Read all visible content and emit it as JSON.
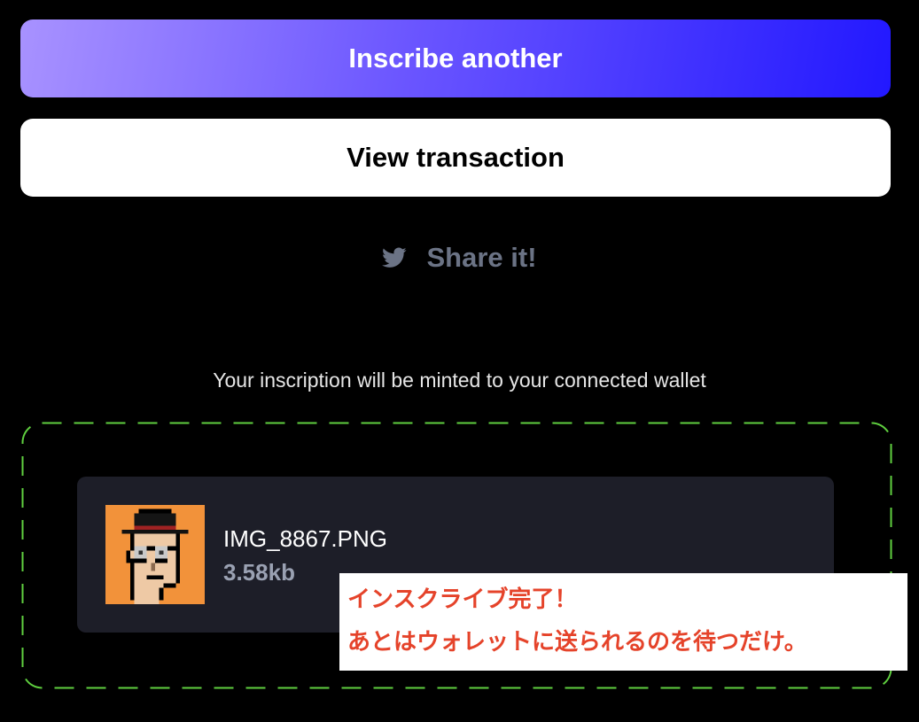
{
  "actions": {
    "inscribe_another_label": "Inscribe another",
    "view_transaction_label": "View transaction",
    "share_label": "Share it!"
  },
  "mint_note": "Your inscription will be minted to your connected wallet",
  "file": {
    "name": "IMG_8867.PNG",
    "size": "3.58kb"
  },
  "annotation": {
    "line1": "インスクライブ完了！",
    "line2": "あとはウォレットに送られるのを待つだけ。"
  },
  "icons": {
    "share_icon": "twitter-bird-icon",
    "thumbnail": "pixel-punk-avatar"
  },
  "colors": {
    "gradient_start": "#a892ff",
    "gradient_end": "#2218ff",
    "dropzone_border": "#5fcf3f",
    "share_text": "#6b7385",
    "card_bg": "#1d1e28",
    "annotation_text": "#e5432a"
  }
}
